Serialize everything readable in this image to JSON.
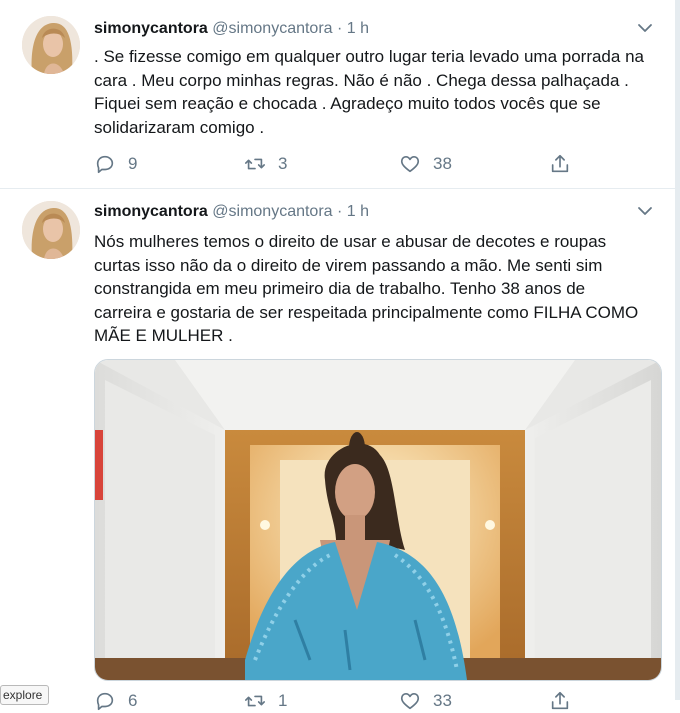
{
  "tweets": [
    {
      "display_name": "simonycantora",
      "handle": "@simonycantora",
      "time": "· 1 h",
      "text": ". Se fizesse comigo em qualquer outro lugar teria levado uma porrada na\ncara . Meu corpo minhas regras. Não é não . Chega dessa palhaçada .\nFiquei sem reação e chocada . Agradeço muito todos vocês que se\nsolidarizaram comigo .",
      "replies": "9",
      "retweets": "3",
      "likes": "38"
    },
    {
      "display_name": "simonycantora",
      "handle": "@simonycantora",
      "time": "· 1 h",
      "text": "Nós mulheres temos o direito de usar e abusar de decotes e roupas\ncurtas isso não da o direito de virem passando a mão. Me senti sim\nconstrangida em meu primeiro dia de trabalho.  Tenho 38 anos de\ncarreira e gostaria de ser respeitada principalmente como FILHA COMO\nMÃE E MULHER .",
      "replies": "6",
      "retweets": "1",
      "likes": "33"
    }
  ],
  "icons": {
    "reply": "reply-icon",
    "retweet": "retweet-icon",
    "like": "heart-icon",
    "share": "share-icon",
    "caret": "chevron-down-icon"
  },
  "tooltip": {
    "explore": "explore"
  },
  "colors": {
    "text_primary": "#14171a",
    "text_secondary": "#657786",
    "divider": "#e6ecf0",
    "media_dress": "#4aa6c9"
  }
}
